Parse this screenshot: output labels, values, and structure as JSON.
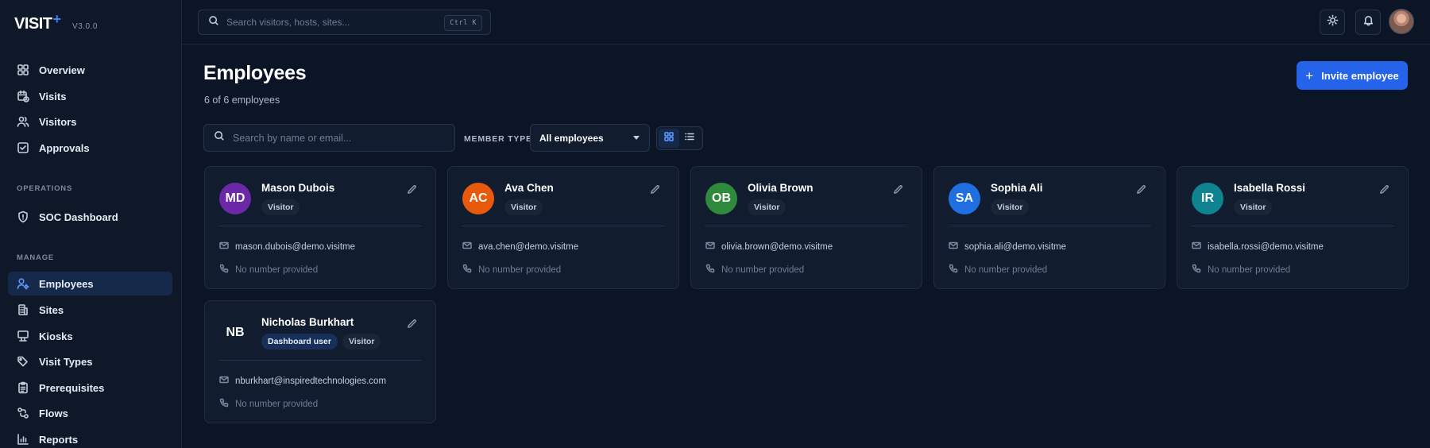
{
  "app": {
    "logo_text": "VISIT",
    "logo_plus": "+",
    "version": "V3.0.0"
  },
  "sidebar": {
    "main_items": [
      {
        "label": "Overview",
        "icon": "grid-icon"
      },
      {
        "label": "Visits",
        "icon": "calendar-clock-icon"
      },
      {
        "label": "Visitors",
        "icon": "users-icon"
      },
      {
        "label": "Approvals",
        "icon": "check-square-icon"
      }
    ],
    "operations_heading": "OPERATIONS",
    "operations_items": [
      {
        "label": "SOC Dashboard",
        "icon": "shield-icon"
      }
    ],
    "manage_heading": "MANAGE",
    "manage_items": [
      {
        "label": "Employees",
        "icon": "user-cog-icon",
        "active": true
      },
      {
        "label": "Sites",
        "icon": "building-icon"
      },
      {
        "label": "Kiosks",
        "icon": "kiosk-icon"
      },
      {
        "label": "Visit Types",
        "icon": "tags-icon"
      },
      {
        "label": "Prerequisites",
        "icon": "clipboard-icon"
      },
      {
        "label": "Flows",
        "icon": "flow-icon"
      },
      {
        "label": "Reports",
        "icon": "bar-chart-icon"
      }
    ]
  },
  "topbar": {
    "search_placeholder": "Search visitors, hosts, sites...",
    "shortcut": "Ctrl K"
  },
  "page": {
    "title": "Employees",
    "count": "6 of 6 employees",
    "invite_label": "Invite employee"
  },
  "filters": {
    "search_placeholder": "Search by name or email...",
    "member_type_label": "MEMBER TYPE",
    "member_type_value": "All employees",
    "view": "grid"
  },
  "employees": [
    {
      "initials": "MD",
      "name": "Mason Dubois",
      "badges": [
        "Visitor"
      ],
      "email": "mason.dubois@demo.visitme",
      "phone": "No number provided",
      "color": "#6d28a8"
    },
    {
      "initials": "AC",
      "name": "Ava Chen",
      "badges": [
        "Visitor"
      ],
      "email": "ava.chen@demo.visitme",
      "phone": "No number provided",
      "color": "#e8590c"
    },
    {
      "initials": "OB",
      "name": "Olivia Brown",
      "badges": [
        "Visitor"
      ],
      "email": "olivia.brown@demo.visitme",
      "phone": "No number provided",
      "color": "#2f8a3c"
    },
    {
      "initials": "SA",
      "name": "Sophia Ali",
      "badges": [
        "Visitor"
      ],
      "email": "sophia.ali@demo.visitme",
      "phone": "No number provided",
      "color": "#1f6fe0"
    },
    {
      "initials": "IR",
      "name": "Isabella Rossi",
      "badges": [
        "Visitor"
      ],
      "email": "isabella.rossi@demo.visitme",
      "phone": "No number provided",
      "color": "#0f8390"
    },
    {
      "initials": "NB",
      "name": "Nicholas Burkhart",
      "badges": [
        "Dashboard user",
        "Visitor"
      ],
      "email": "nburkhart@inspiredtechnologies.com",
      "phone": "No number provided",
      "color": "#111c2e"
    }
  ]
}
